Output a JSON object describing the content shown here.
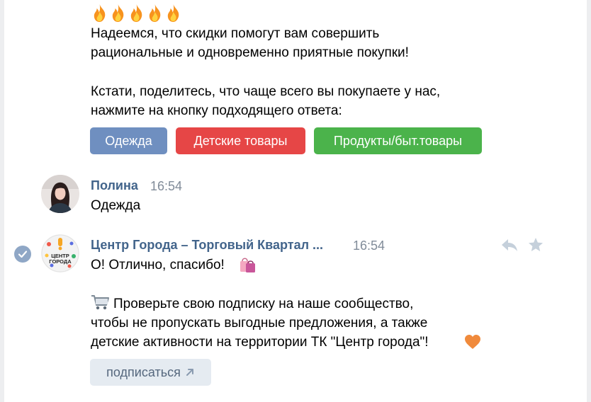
{
  "message_top": {
    "emoji": [
      "fire-emoji",
      "fire-emoji",
      "fire-emoji",
      "fire-emoji",
      "fire-emoji"
    ],
    "lines": [
      "Надеемся, что скидки помогут вам совершить",
      "рациональные и одновременно приятные покупки!",
      "Кстати, поделитесь, что чаще всего вы покупаете у нас,",
      "нажмите на кнопку подходящего ответа:"
    ],
    "buttons": [
      {
        "label": "Одежда",
        "color": "#6f8fc0"
      },
      {
        "label": "Детские товары",
        "color": "#e64646"
      },
      {
        "label": "Продукты/быт.товары",
        "color": "#4bb34b"
      }
    ]
  },
  "message_user": {
    "author": "Полина",
    "time": "16:54",
    "text": "Одежда"
  },
  "message_group": {
    "author": "Центр Города – Торговый Квартал ...",
    "time": "16:54",
    "avatar_text": "ЦЕНТР ГОРОДА",
    "line1": "О! Отлично, спасибо!",
    "line2": "Проверьте свою подписку на наше сообщество,",
    "line3": "чтобы не пропускать выгодные предложения, а также",
    "line4": "детские активности на территории ТК \"Центр города\"!",
    "subscribe_label": "подписаться"
  },
  "colors": {
    "author": "#42648b",
    "time": "#818c99",
    "accent": "#5181b8"
  }
}
